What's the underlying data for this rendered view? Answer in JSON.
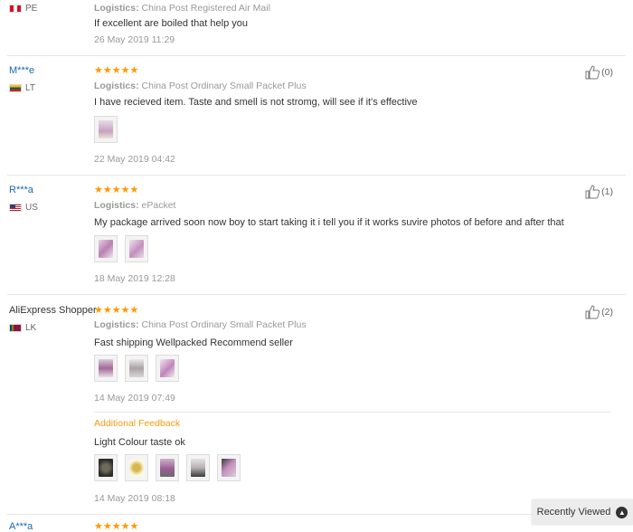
{
  "reviews": [
    {
      "user": "",
      "country_code": "PE",
      "logistics_label": "Logistics:",
      "logistics": "China Post Registered Air Mail",
      "text": "If excellent are boiled that help you",
      "date": "26 May 2019 11:29",
      "helpful": ""
    },
    {
      "user": "M***e",
      "country_code": "LT",
      "stars": "★★★★★",
      "logistics_label": "Logistics:",
      "logistics": "China Post Ordinary Small Packet Plus",
      "text": "I have recieved item. Taste and smell is not stromg, will see if it's effective",
      "date": "22 May 2019 04:42",
      "helpful": "(0)"
    },
    {
      "user": "R***a",
      "country_code": "US",
      "stars": "★★★★★",
      "logistics_label": "Logistics:",
      "logistics": "ePacket",
      "text": "My package arrived soon now boy to start taking it i tell you if it works suvire photos of before and after that",
      "date": "18 May 2019 12:28",
      "helpful": "(1)"
    },
    {
      "user": "AliExpress Shopper",
      "country_code": "LK",
      "stars": "★★★★★",
      "logistics_label": "Logistics:",
      "logistics": "China Post Ordinary Small Packet Plus",
      "text": "Fast shipping Wellpacked Recommend seller",
      "date": "14 May 2019 07:49",
      "helpful": "(2)",
      "additional_title": "Additional Feedback",
      "additional_text": "Light Colour taste ok",
      "additional_date": "14 May 2019 08:18"
    },
    {
      "user": "A***a",
      "stars": "★★★★★"
    }
  ],
  "recently_viewed": "Recently Viewed",
  "colors": {
    "star": "#ff9900",
    "link": "#1a66b3",
    "feedback": "#f39c12"
  }
}
